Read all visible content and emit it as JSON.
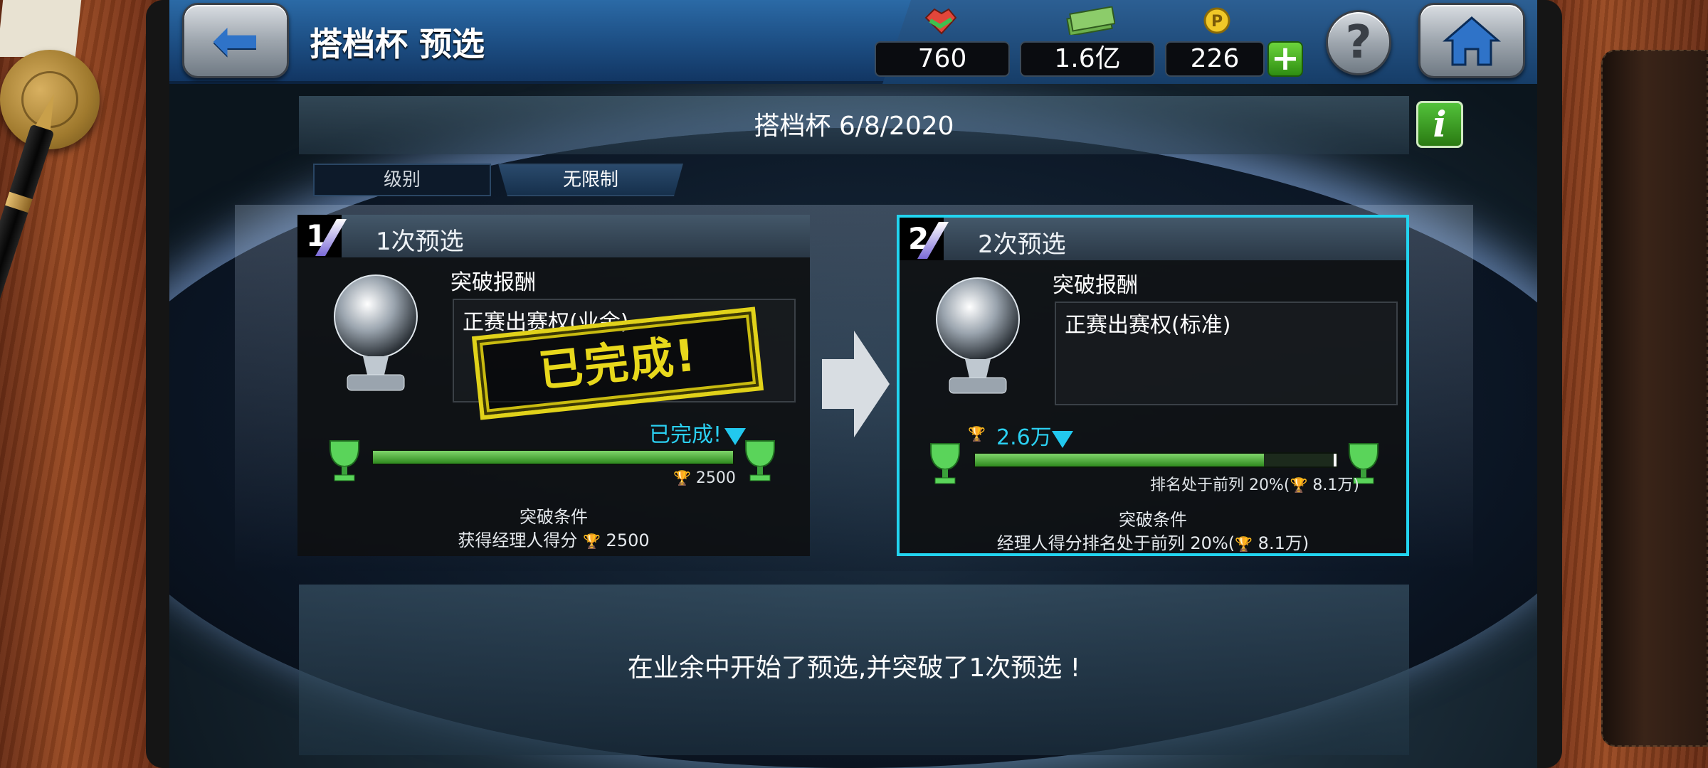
{
  "header": {
    "title": "搭档杯 预选",
    "stats": {
      "handshake": "760",
      "money": "1.6亿",
      "points": "226"
    }
  },
  "cup": {
    "title": "搭档杯 6/8/2020",
    "level_label": "级别",
    "level_value": "无限制"
  },
  "stages": [
    {
      "number": "1",
      "title": "1次预选",
      "reward_label": "突破报酬",
      "reward": "正赛出赛权(业余)",
      "stamp": "已完成!",
      "marker_text": "已完成!",
      "target_note": "2500",
      "progress": 1.0,
      "condition_title": "突破条件",
      "condition_text": "获得经理人得分",
      "condition_value": "2500"
    },
    {
      "number": "2",
      "title": "2次预选",
      "reward_label": "突破报酬",
      "reward": "正赛出赛权(标准)",
      "marker_text": "2.6万",
      "target_note": "排名处于前列 20%(",
      "target_value": "8.1万)",
      "progress": 0.8,
      "condition_title": "突破条件",
      "condition_text": "经理人得分排名处于前列 20%(",
      "condition_value": "8.1万)"
    }
  ],
  "message": "在业余中开始了预选,并突破了1次预选 !",
  "colors": {
    "accent_cyan": "#22d4f0",
    "stamp_yellow": "#e1d21a",
    "bar_green": "#2e8a1e",
    "topbar_blue": "#1c4d82"
  },
  "icons": [
    "back-arrow-icon",
    "home-icon",
    "help-icon",
    "handshake-icon",
    "money-icon",
    "points-coin-icon",
    "plus-icon",
    "info-icon",
    "trophy-icon",
    "green-cup-icon",
    "right-arrow-icon"
  ]
}
